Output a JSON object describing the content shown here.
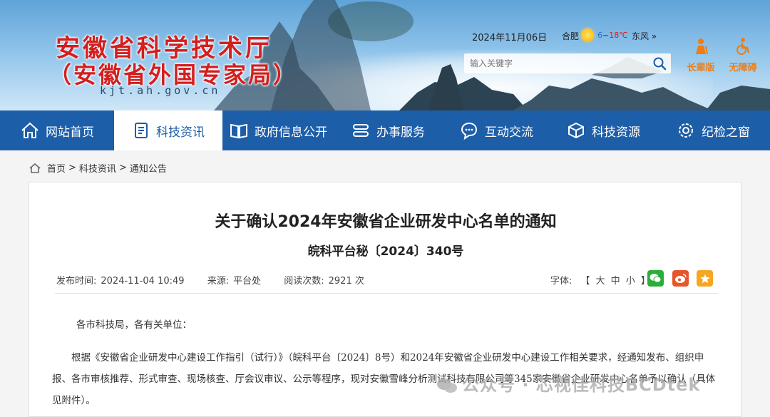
{
  "header": {
    "title": "安徽省科学技术厅",
    "subtitle": "（安徽省外国专家局）",
    "domain": "kjt.ah.gov.cn",
    "date": "2024年11月06日",
    "weather": {
      "city": "合肥",
      "temp_low": "6",
      "temp_sep": "~",
      "temp_high": "18℃",
      "wind": "东风 »",
      "icon": "sun-icon"
    },
    "search": {
      "placeholder": "输入关键字",
      "icon": "search-icon"
    },
    "elder_mode": "长辈版",
    "accessibility": "无障碍"
  },
  "nav": {
    "items": [
      {
        "label": "网站首页",
        "icon": "home-icon"
      },
      {
        "label": "科技资讯",
        "icon": "document-icon",
        "active": true
      },
      {
        "label": "政府信息公开",
        "icon": "book-icon"
      },
      {
        "label": "办事服务",
        "icon": "service-icon"
      },
      {
        "label": "互动交流",
        "icon": "chat-icon"
      },
      {
        "label": "科技资源",
        "icon": "cube-icon"
      },
      {
        "label": "纪检之窗",
        "icon": "gear-icon"
      }
    ]
  },
  "breadcrumb": [
    "首页",
    ">",
    "科技资讯",
    ">",
    "通知公告"
  ],
  "article": {
    "title": "关于确认2024年安徽省企业研发中心名单的通知",
    "doc_number": "皖科平台秘〔2024〕340号",
    "publish_label": "发布时间:",
    "publish_time": "2024-11-04 10:49",
    "source_label": "来源:",
    "source": "平台处",
    "views_label": "阅读次数:",
    "views": "2921 次",
    "font_label": "字体:",
    "font_sizes": "【 大 中 小 】",
    "share": [
      {
        "name": "wechat",
        "color": "#2aae3a"
      },
      {
        "name": "weibo",
        "color": "#e5572b"
      },
      {
        "name": "favorite",
        "color": "#f5a623"
      }
    ],
    "salutation": "各市科技局，各有关单位：",
    "paragraph": "根据《安徽省企业研发中心建设工作指引（试行）》（皖科平台〔2024〕8号）和2024年安徽省企业研发中心建设工作相关要求，经通知发布、组织申报、各市审核推荐、形式审查、现场核查、厅会议审议、公示等程序，现对安徽雪峰分析测试科技有限公司等345家安徽省企业研发中心名单予以确认（具体见附件）。"
  },
  "watermark": "公众号 · 芯视佳科技BCDtek"
}
